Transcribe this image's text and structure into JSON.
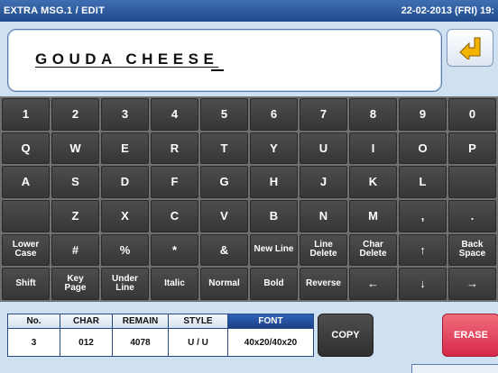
{
  "header": {
    "title": "EXTRA MSG.1 / EDIT",
    "datetime": "22-02-2013 (FRI) 19:"
  },
  "editor": {
    "text": "GOUDA CHEESE"
  },
  "keyboard": {
    "rows": [
      [
        "1",
        "2",
        "3",
        "4",
        "5",
        "6",
        "7",
        "8",
        "9",
        "0"
      ],
      [
        "Q",
        "W",
        "E",
        "R",
        "T",
        "Y",
        "U",
        "I",
        "O",
        "P"
      ],
      [
        "A",
        "S",
        "D",
        "F",
        "G",
        "H",
        "J",
        "K",
        "L",
        ""
      ],
      [
        "",
        "Z",
        "X",
        "C",
        "V",
        "B",
        "N",
        "M",
        ",",
        "."
      ],
      [
        "Lower\nCase",
        "#",
        "%",
        "*",
        "&",
        "New Line",
        "Line\nDelete",
        "Char\nDelete",
        "↑",
        "Back\nSpace"
      ],
      [
        "Shift",
        "Key\nPage",
        "Under\nLine",
        "Italic",
        "Normal",
        "Bold",
        "Reverse",
        "←",
        "↓",
        "→"
      ]
    ]
  },
  "status": {
    "no_label": "No.",
    "no_value": "3",
    "char_label": "CHAR",
    "char_value": "012",
    "remain_label": "REMAIN",
    "remain_value": "4078",
    "style_label": "STYLE",
    "style_value": "U / U",
    "font_label": "FONT",
    "font_value": "40x20/40x20"
  },
  "actions": {
    "copy_label": "COPY",
    "erase_label": "ERASE"
  },
  "colors": {
    "title_bar": "#1f4a8c",
    "background": "#cfe0f1",
    "key": "#3f3f3f",
    "erase": "#d7284a"
  },
  "icons": {
    "back": "return-arrow-icon"
  }
}
